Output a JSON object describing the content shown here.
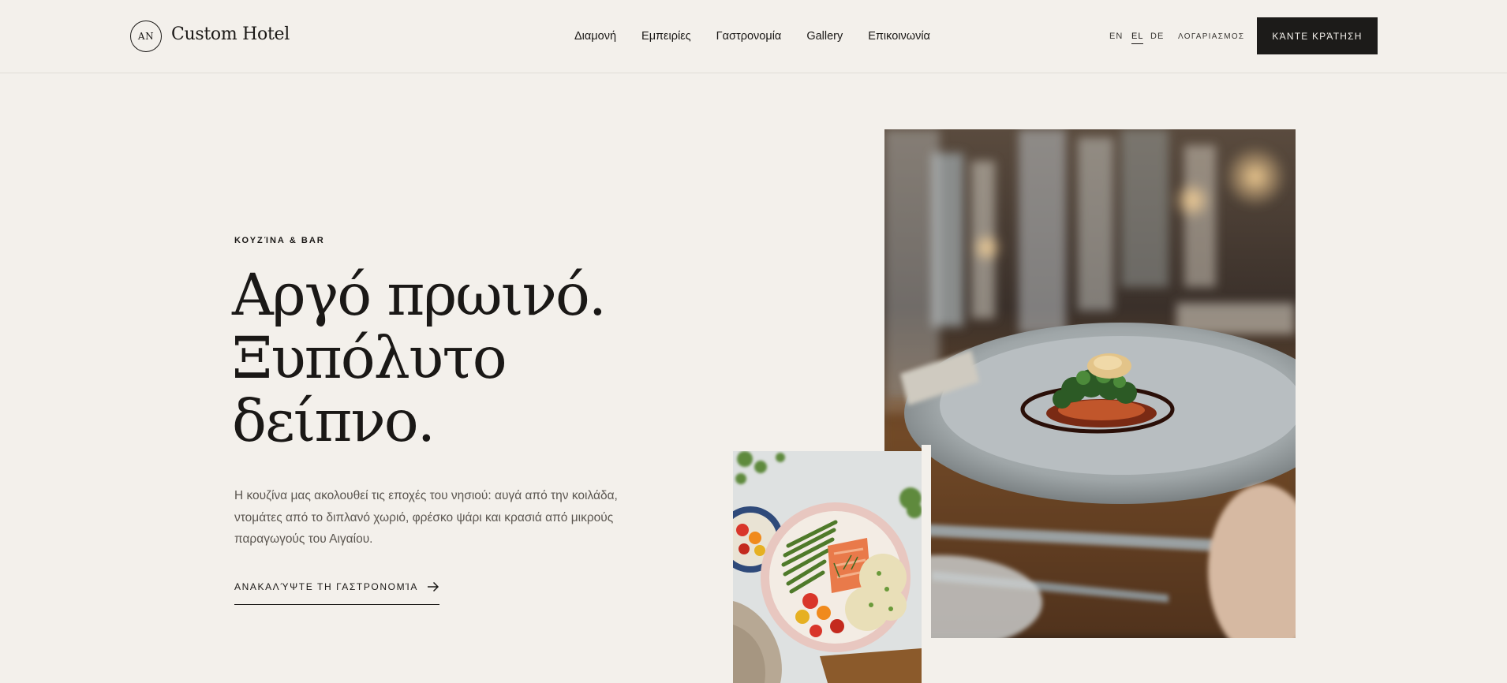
{
  "header": {
    "logo_mark": "AN",
    "logo_text": "Custom Hotel",
    "nav": [
      "Διαμονή",
      "Εμπειρίες",
      "Γαστρονομία",
      "Gallery",
      "Επικοινωνία"
    ],
    "languages": [
      "EN",
      "EL",
      "DE"
    ],
    "active_language": "EL",
    "account_label": "ΛΟΓΑΡΙΑΣΜΟΣ",
    "book_label": "ΚΆΝΤΕ ΚΡΆΤΗΣΗ"
  },
  "hero": {
    "eyebrow": "ΚΟΥΖΊΝΑ & BAR",
    "headline": [
      "Αργό πρωινό.",
      "Ξυπόλυτο",
      "δείπνο."
    ],
    "body": "Η κουζίνα μας ακολουθεί τις εποχές του νησιού: αυγά από την κοιλάδα, ντομάτες από το διπλανό χωριό, φρέσκο ψάρι και κρασιά από μικρούς παραγωγούς του Αιγαίου.",
    "cta_label": "ΑΝΑΚΑΛΎΨΤΕ ΤΗ ΓΑΣΤΡΟΝΟΜΊΑ"
  },
  "images": {
    "main": "plated-fish-dish-on-restaurant-table",
    "secondary": "salmon-green-beans-couscous-bowl"
  },
  "colors": {
    "background": "#f3f0eb",
    "ink": "#1a1816",
    "muted": "#5b5650",
    "button": "#1c1b19"
  }
}
